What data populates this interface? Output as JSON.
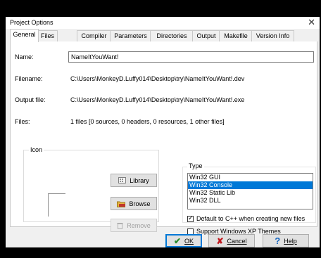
{
  "window": {
    "title": "Project Options",
    "close_glyph": "✕"
  },
  "tabs": [
    {
      "label": "General"
    },
    {
      "label": "Files"
    },
    {
      "label": "Compiler"
    },
    {
      "label": "Parameters"
    },
    {
      "label": "Directories"
    },
    {
      "label": "Output"
    },
    {
      "label": "Makefile"
    },
    {
      "label": "Version Info"
    }
  ],
  "general": {
    "name_label": "Name:",
    "name_value": "NameItYouWant!",
    "filename_label": "Filename:",
    "filename_value": "C:\\Users\\MonkeyD.Luffy014\\Desktop\\try\\NameItYouWant!.dev",
    "output_label": "Output file:",
    "output_value": "C:\\Users\\MonkeyD.Luffy014\\Desktop\\try\\NameItYouWant!.exe",
    "files_label": "Files:",
    "files_value": "1 files [0 sources, 0 headers, 0 resources, 1 other files]"
  },
  "icon_group": {
    "title": "Icon",
    "library_label": "Library",
    "browse_label": "Browse",
    "remove_label": "Remove"
  },
  "type_group": {
    "title": "Type",
    "options": [
      "Win32 GUI",
      "Win32 Console",
      "Win32 Static Lib",
      "Win32 DLL"
    ],
    "selected": "Win32 Console",
    "default_cpp_label": "Default to C++ when creating new files",
    "default_cpp_checked": true,
    "xp_themes_label": "Support Windows XP Themes",
    "xp_themes_checked": false
  },
  "footer": {
    "ok_label": "OK",
    "cancel_label": "Cancel",
    "help_label": "Help"
  },
  "colors": {
    "selection": "#0078d7",
    "ok_check": "#2a8a2a",
    "cancel_x": "#c0181e",
    "help_q": "#1565c0"
  }
}
